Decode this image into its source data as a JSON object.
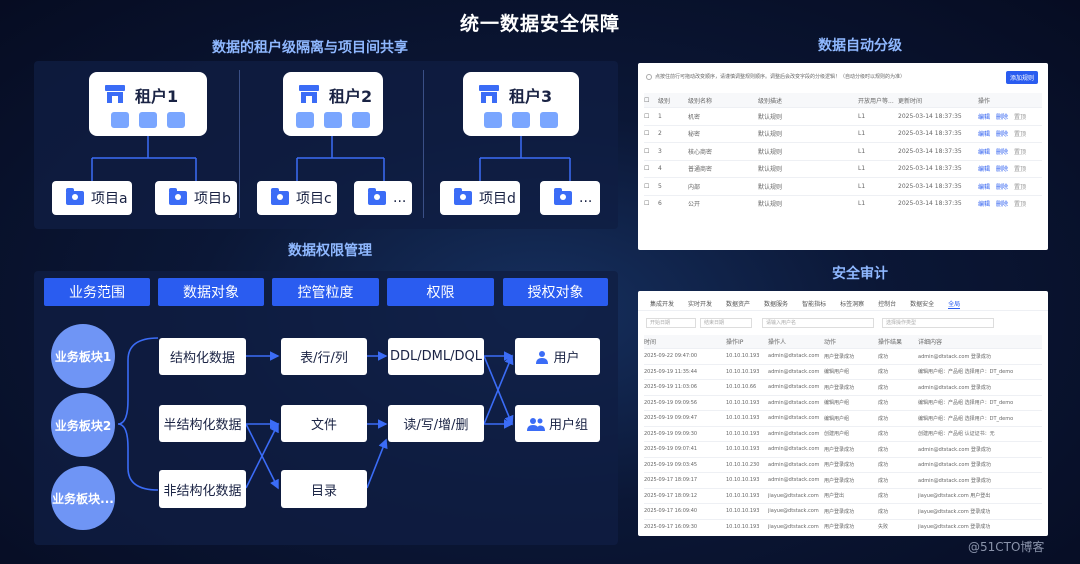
{
  "title": "统一数据安全保障",
  "tenant_section": {
    "title": "数据的租户级隔离与项目间共享",
    "tenants": [
      {
        "name": "租户1",
        "icons": [
          "mic-icon",
          "image-icon",
          "card-icon"
        ],
        "projects": [
          "项目a",
          "项目b"
        ]
      },
      {
        "name": "租户2",
        "icons": [
          "mail-icon",
          "video-icon",
          "grid-icon"
        ],
        "projects": [
          "项目c",
          "..."
        ]
      },
      {
        "name": "租户3",
        "icons": [
          "box-icon",
          "doc-icon",
          "calendar-icon"
        ],
        "projects": [
          "项目d",
          "..."
        ]
      }
    ]
  },
  "permission_section": {
    "title": "数据权限管理",
    "headers": [
      "业务范围",
      "数据对象",
      "控管粒度",
      "权限",
      "授权对象"
    ],
    "scopes": [
      "业务板块1",
      "业务板块2",
      "业务板块..."
    ],
    "objects": [
      "结构化数据",
      "半结构化数据",
      "非结构化数据"
    ],
    "granularity": [
      "表/行/列",
      "文件",
      "目录"
    ],
    "permissions": [
      "DDL/DML/DQL",
      "读/写/增/删"
    ],
    "grantees": [
      "用户",
      "用户组"
    ]
  },
  "classification_section": {
    "title": "数据自动分级",
    "hint": "点按住前行可拖动改变顺序，请谨慎调整规则顺序。调整后会改变字段的分级逻辑！（自动分级时以规则的为准）",
    "add_button": "添加规则",
    "columns": [
      "级别",
      "级别名称",
      "级别描述",
      "开放用户等...",
      "更新时间",
      "操作"
    ],
    "rows": [
      {
        "level": "1",
        "name": "机密",
        "desc": "默认规则",
        "open": "L1",
        "time": "2025-03-14 18:37:35"
      },
      {
        "level": "2",
        "name": "秘密",
        "desc": "默认规则",
        "open": "L1",
        "time": "2025-03-14 18:37:35"
      },
      {
        "level": "3",
        "name": "核心商密",
        "desc": "默认规则",
        "open": "L1",
        "time": "2025-03-14 18:37:35"
      },
      {
        "level": "4",
        "name": "普通商密",
        "desc": "默认规则",
        "open": "L1",
        "time": "2025-03-14 18:37:35"
      },
      {
        "level": "5",
        "name": "内部",
        "desc": "默认规则",
        "open": "L1",
        "time": "2025-03-14 18:37:35"
      },
      {
        "level": "6",
        "name": "公开",
        "desc": "默认规则",
        "open": "L1",
        "time": "2025-03-14 18:37:35"
      }
    ],
    "actions": [
      "编辑",
      "删除",
      "置顶"
    ]
  },
  "audit_section": {
    "title": "安全审计",
    "tabs": [
      "集成开发",
      "实时开发",
      "数据资产",
      "数据服务",
      "智能指标",
      "标签洞察",
      "控制台",
      "数据安全",
      "全局"
    ],
    "active_tab": "全局",
    "filters": {
      "start": "开始日期",
      "end": "结束日期",
      "user": "请输入用户名",
      "type": "选择操作类型"
    },
    "columns": [
      "时间",
      "操作IP",
      "操作人",
      "动作",
      "操作结果",
      "详细内容"
    ],
    "rows": [
      {
        "time": "2025-09-22 09:47:00",
        "ip": "10.10.10.193",
        "user": "admin@dtstack.com",
        "action": "用户登录成功",
        "result": "成功",
        "detail": "admin@dtstack.com 登录成功"
      },
      {
        "time": "2025-09-19 11:35:44",
        "ip": "10.10.10.193",
        "user": "admin@dtstack.com",
        "action": "编辑用户组",
        "result": "成功",
        "detail": "编辑用户组：产品组  选择用户：DT_demo"
      },
      {
        "time": "2025-09-19 11:03:06",
        "ip": "10.10.10.66",
        "user": "admin@dtstack.com",
        "action": "用户登录成功",
        "result": "成功",
        "detail": "admin@dtstack.com 登录成功"
      },
      {
        "time": "2025-09-19 09:09:56",
        "ip": "10.10.10.193",
        "user": "admin@dtstack.com",
        "action": "编辑用户组",
        "result": "成功",
        "detail": "编辑用户组：产品组  选择用户：DT_demo"
      },
      {
        "time": "2025-09-19 09:09:47",
        "ip": "10.10.10.193",
        "user": "admin@dtstack.com",
        "action": "编辑用户组",
        "result": "成功",
        "detail": "编辑用户组：产品组  选择用户：DT_demo"
      },
      {
        "time": "2025-09-19 09:09:30",
        "ip": "10.10.10.193",
        "user": "admin@dtstack.com",
        "action": "创建用户组",
        "result": "成功",
        "detail": "创建用户组：产品组 认证证书：无"
      },
      {
        "time": "2025-09-19 09:07:41",
        "ip": "10.10.10.193",
        "user": "admin@dtstack.com",
        "action": "用户登录成功",
        "result": "成功",
        "detail": "admin@dtstack.com 登录成功"
      },
      {
        "time": "2025-09-19 09:03:45",
        "ip": "10.10.10.230",
        "user": "admin@dtstack.com",
        "action": "用户登录成功",
        "result": "成功",
        "detail": "admin@dtstack.com 登录成功"
      },
      {
        "time": "2025-09-17 18:09:17",
        "ip": "10.10.10.193",
        "user": "admin@dtstack.com",
        "action": "用户登录成功",
        "result": "成功",
        "detail": "admin@dtstack.com 登录成功"
      },
      {
        "time": "2025-09-17 18:09:12",
        "ip": "10.10.10.193",
        "user": "jiayue@dtstack.com",
        "action": "用户登出",
        "result": "成功",
        "detail": "jiayue@dtstack.com 用户登出"
      },
      {
        "time": "2025-09-17 16:09:40",
        "ip": "10.10.10.193",
        "user": "jiayue@dtstack.com",
        "action": "用户登录成功",
        "result": "成功",
        "detail": "jiayue@dtstack.com 登录成功"
      },
      {
        "time": "2025-09-17 16:09:30",
        "ip": "10.10.10.193",
        "user": "jiayue@dtstack.com",
        "action": "用户登录成功",
        "result": "失败",
        "detail": "jiayue@dtstack.com 登录成功"
      }
    ]
  },
  "watermark": "@51CTO博客"
}
